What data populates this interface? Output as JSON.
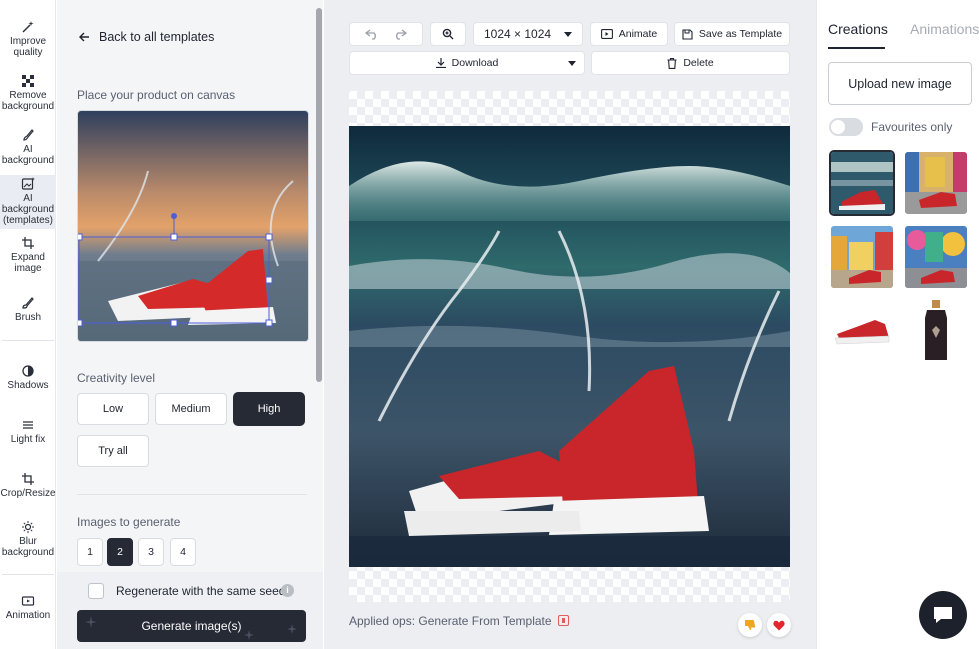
{
  "tools": [
    {
      "label": "Improve quality",
      "icon": "magic-wand-icon"
    },
    {
      "label": "Remove background",
      "icon": "checker-icon"
    },
    {
      "label": "AI background",
      "icon": "brush-sparkle-icon"
    },
    {
      "label": "AI background (templates)",
      "icon": "template-image-icon"
    },
    {
      "label": "Expand image",
      "icon": "expand-icon"
    },
    {
      "label": "Brush",
      "icon": "brush-icon"
    },
    {
      "label": "Shadows",
      "icon": "shadow-icon"
    },
    {
      "label": "Light fix",
      "icon": "light-icon"
    },
    {
      "label": "Crop/Resize",
      "icon": "crop-icon"
    },
    {
      "label": "Blur background",
      "icon": "blur-icon"
    },
    {
      "label": "Animation",
      "icon": "animation-icon"
    }
  ],
  "panel": {
    "back_label": "Back to all templates",
    "place_label": "Place your product on canvas",
    "creativity_label": "Creativity level",
    "creativity_options": [
      "Low",
      "Medium",
      "High"
    ],
    "creativity_selected": "High",
    "try_all_label": "Try all",
    "images_label": "Images to generate",
    "image_counts": [
      "1",
      "2",
      "3",
      "4"
    ],
    "image_count_selected": "2",
    "regen_label": "Regenerate with the same seed",
    "regen_checked": false,
    "generate_label": "Generate image(s)"
  },
  "toolbar": {
    "size_value": "1024 × 1024",
    "animate_label": "Animate",
    "save_template_label": "Save as Template",
    "download_label": "Download",
    "delete_label": "Delete"
  },
  "canvas": {
    "applied_ops": "Applied ops: Generate From Template"
  },
  "right": {
    "tab_creations": "Creations",
    "tab_animations": "Animations",
    "upload_label": "Upload new image",
    "favourites_label": "Favourites only",
    "favourites_on": false
  },
  "colors": {
    "accent_dark": "#262a35",
    "panel_bg": "#f4f5f7",
    "canvas_bg": "#eceef1"
  }
}
